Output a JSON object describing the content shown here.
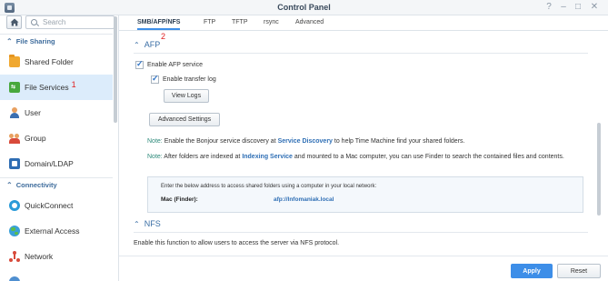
{
  "window": {
    "title": "Control Panel",
    "controls": [
      "?",
      "–",
      "□",
      "✕"
    ]
  },
  "sidebar": {
    "search_placeholder": "Search",
    "sections": [
      {
        "label": "File Sharing"
      },
      {
        "label": "Connectivity"
      }
    ],
    "items": [
      {
        "label": "Shared Folder",
        "icon": "folder-icon"
      },
      {
        "label": "File Services",
        "icon": "file-services-icon",
        "marker": "1"
      },
      {
        "label": "User",
        "icon": "user-icon"
      },
      {
        "label": "Group",
        "icon": "group-icon"
      },
      {
        "label": "Domain/LDAP",
        "icon": "domain-icon"
      },
      {
        "label": "QuickConnect",
        "icon": "quickconnect-icon"
      },
      {
        "label": "External Access",
        "icon": "globe-icon"
      },
      {
        "label": "Network",
        "icon": "network-icon"
      }
    ]
  },
  "tabs": [
    {
      "label": "SMB/AFP/NFS",
      "marker": "2"
    },
    {
      "label": "FTP"
    },
    {
      "label": "TFTP"
    },
    {
      "label": "rsync"
    },
    {
      "label": "Advanced"
    }
  ],
  "afp": {
    "title": "AFP",
    "enable_label": "Enable AFP service",
    "transfer_log_label": "Enable transfer log",
    "view_logs": "View Logs",
    "advanced_settings": "Advanced Settings",
    "note1_label": "Note:",
    "note1_pre": "Enable the Bonjour service discovery at",
    "note1_link": "Service Discovery",
    "note1_post": "to help Time Machine find your shared folders.",
    "note2_label": "Note:",
    "note2_pre": "After folders are indexed at",
    "note2_link": "Indexing Service",
    "note2_post": "and mounted to a Mac computer, you can use Finder to search the contained files and contents.",
    "address_intro": "Enter the below address to access shared folders using a computer in your local network:",
    "mac_label": "Mac (Finder):",
    "mac_value": "afp://Infomaniak.local"
  },
  "nfs": {
    "title": "NFS",
    "description": "Enable this function to allow users to access the server via NFS protocol."
  },
  "footer": {
    "apply": "Apply",
    "reset": "Reset"
  },
  "colors": {
    "accent": "#3d8ee8",
    "active_nav": "#dcecfb",
    "marker": "#e02020"
  }
}
